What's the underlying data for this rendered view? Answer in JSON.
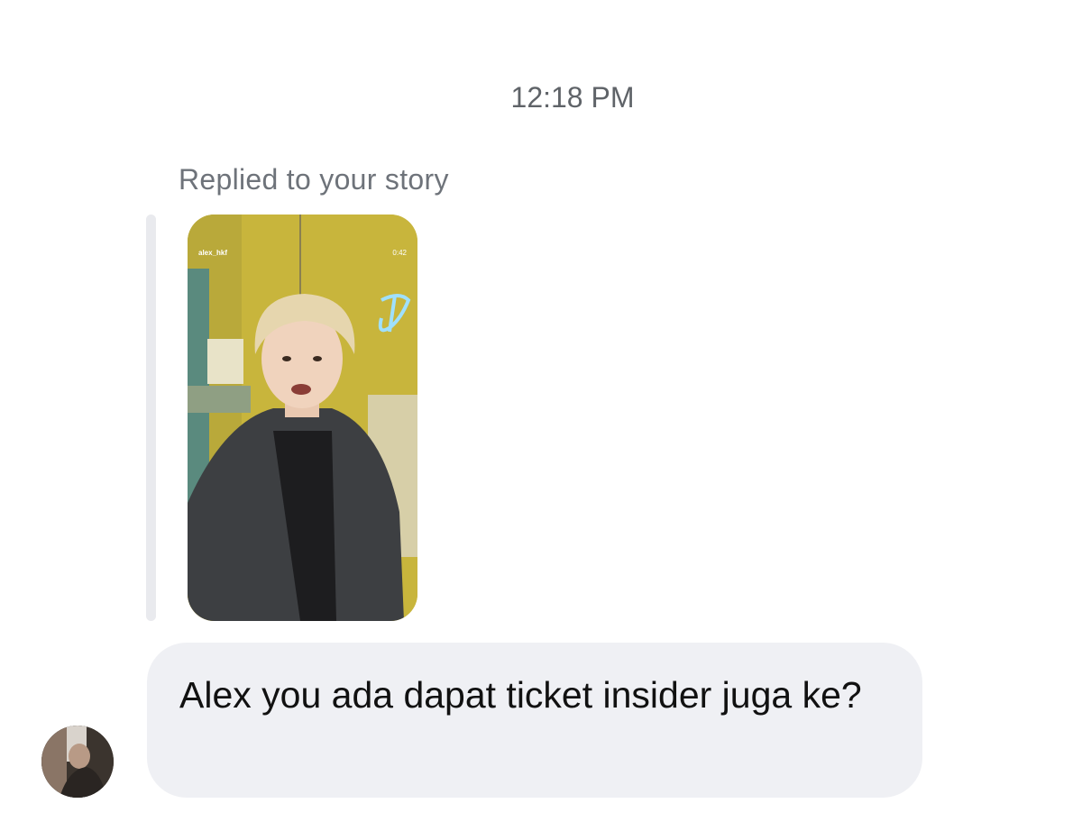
{
  "timestamp": "12:18 PM",
  "reply": {
    "label": "Replied to your story",
    "story": {
      "username": "alex_hkf",
      "duration": "0:42"
    }
  },
  "message": {
    "text": "Alex you ada dapat ticket insider juga ke?"
  },
  "colors": {
    "bubble_bg": "#eff0f4",
    "meta_text": "#6e737a",
    "story_bg": "#c9b43a"
  },
  "icons": {
    "avatar": "sender-avatar"
  }
}
